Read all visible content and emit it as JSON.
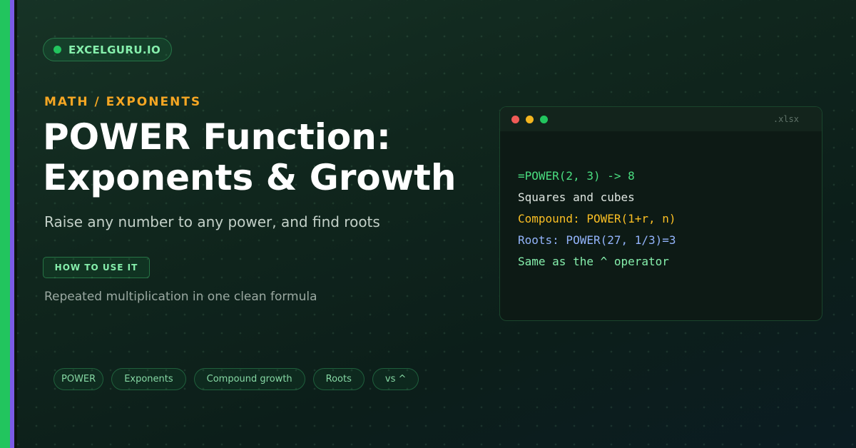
{
  "brand": {
    "label": "EXCELGURU.IO"
  },
  "hero": {
    "eyebrow": "MATH / EXPONENTS",
    "title_line1": "POWER Function:",
    "title_line2": "Exponents & Growth",
    "subtitle": "Raise any number to any power, and find roots",
    "cta_label": "HOW TO USE IT",
    "description": "Repeated multiplication in one clean formula"
  },
  "code_window": {
    "file_label": ".xlsx",
    "lines": [
      {
        "text": "=POWER(2, 3) -> 8",
        "color": "#4ade80"
      },
      {
        "text": "Squares and cubes",
        "color": "#dfe6e1"
      },
      {
        "text": "Compound: POWER(1+r, n)",
        "color": "#fbbf24"
      },
      {
        "text": "Roots: POWER(27, 1/3)=3",
        "color": "#93b4fb"
      },
      {
        "text": "Same as the ^ operator",
        "color": "#86efac"
      }
    ]
  },
  "tags": [
    "POWER",
    "Exponents",
    "Compound growth",
    "Roots",
    "vs ^"
  ],
  "colors": {
    "accent_green": "#22c55e",
    "accent_purple": "#7b5be6",
    "eyebrow_orange": "#f5a623"
  }
}
